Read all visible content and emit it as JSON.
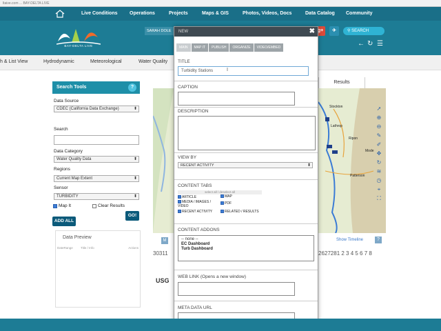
{
  "browser": {
    "url": "ltaive.com ... BAY-DELTA LIVE"
  },
  "header": {
    "nav": [
      "Live Conditions",
      "Operations",
      "Projects",
      "Maps & GIS",
      "Photos, Videos, Docs",
      "Data Catalog",
      "Community"
    ],
    "logo_text": "BAY-DELTA LIVE",
    "user": "SARAH DOLE",
    "social": {
      "google": "g+"
    },
    "search_label": "SEARCH",
    "colors": {
      "header": "#1d7c95",
      "accent": "#2fb3d4"
    }
  },
  "subnav": [
    "h & List View",
    "Hydrodynamic",
    "Meteorological",
    "Water Quality"
  ],
  "search_tools": {
    "title": "Search Tools",
    "help": "?",
    "data_source_label": "Data Source",
    "data_source_value": "CDEC (California Data Exchange)",
    "search_label": "Search",
    "data_category_label": "Data Category",
    "data_category_value": "Water Quality Data",
    "regions_label": "Regions",
    "regions_value": "Current Map Extent",
    "sensor_label": "Sensor",
    "sensor_value": "TURBIDITY",
    "map_it_label": "Map It",
    "clear_results_label": "Clear Results",
    "go_label": "GO!",
    "add_all_label": "ADD ALL",
    "preview_title": "Data Preview",
    "preview_cols": [
      "DateRange",
      "Title / Info",
      "Actions"
    ]
  },
  "map": {
    "results_tab": "Results",
    "labels": [
      "Stockton",
      "Lathrop",
      "Ripon",
      "Mode",
      "Patterson"
    ],
    "show_timeline": "Show Timeline",
    "help": "?",
    "pagination_left": "30311",
    "pagination_right": "2627281 2 3 4 5 6 7 8",
    "usgs": "USG"
  },
  "modal": {
    "header": "NEW",
    "close": "✖",
    "tabs": [
      "MAIN",
      "MAP IT",
      "PUBLISH",
      "ORGANIZE",
      "VIDEO/EMBED"
    ],
    "title_label": "TITLE",
    "title_value": "Turbidity Stations",
    "caption_label": "CAPTION",
    "description_label": "DESCRIPTION",
    "viewby_label": "VIEW BY",
    "viewby_value": "RECENT ACTIVITY",
    "content_tabs_label": "CONTENT TABS",
    "select_all": "select all / deselect all",
    "content_tabs": {
      "article": "ARTICLE",
      "map": "MAP",
      "media": "MEDIA / IMAGES / VIDEO",
      "pdf": "PDF",
      "recent": "RECENT ACTIVITY",
      "related": "RELATED / RESULTS"
    },
    "addons_label": "CONTENT ADDONS",
    "addons": [
      "-- none --",
      "EC Dashboard",
      "Turb Dashboard"
    ],
    "weblink_label": "WEB LINK (Opens a new window)",
    "metadata_label": "META DATA URL"
  }
}
